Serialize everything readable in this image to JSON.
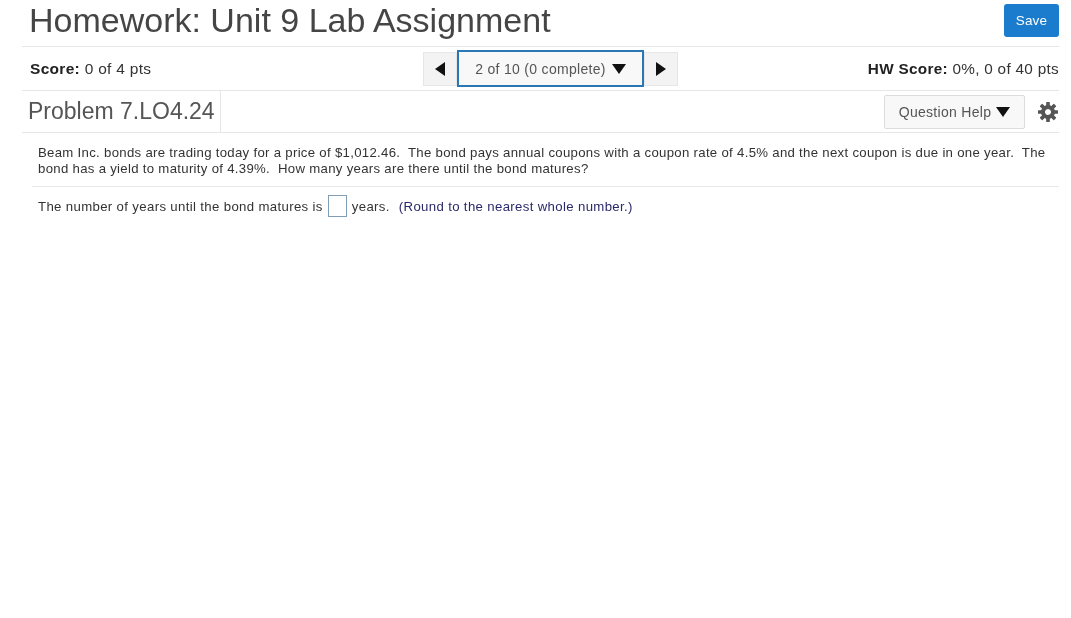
{
  "title": "Homework: Unit 9 Lab Assignment",
  "save_button": "Save",
  "score": {
    "label": "Score:",
    "value": "0 of 4 pts"
  },
  "navigator": {
    "position": "2 of 10 (0 complete)"
  },
  "hw_score": {
    "label": "HW Score:",
    "value": "0%, 0 of 40 pts"
  },
  "problem": {
    "title": "Problem 7.LO4.24",
    "help_button": "Question Help"
  },
  "question": "Beam Inc. bonds are trading today for a price of $1,012.46.  The bond pays annual coupons with a coupon rate of 4.5% and the next coupon is due in one year.  The bond has a yield to maturity of 4.39%.  How many years are there until the bond matures?",
  "answer": {
    "before": "The number of years until the bond matures is",
    "after": "years.",
    "hint": "(Round to the nearest whole number.)"
  }
}
